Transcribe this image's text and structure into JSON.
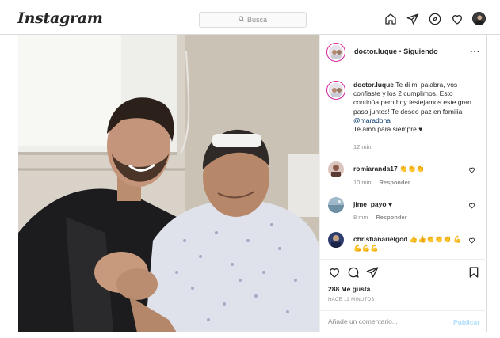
{
  "app": {
    "logo": "Instagram"
  },
  "search": {
    "placeholder": "Busca"
  },
  "nav": {
    "icons": [
      "home-icon",
      "send-icon",
      "explore-icon",
      "heart-icon",
      "profile-avatar"
    ]
  },
  "post": {
    "author": "doctor.luque",
    "follow_status": "Siguiendo",
    "separator": "•",
    "more": "···",
    "caption": {
      "user": "doctor.luque",
      "text": "Te di mi palabra, vos confiaste y los 2 cumplimos. Esto continúa pero hoy festejamos este gran paso juntos! Te deseo paz en familia",
      "mention": "@maradona",
      "text_after": "Te amo para siempre ♥",
      "time": "12 min"
    },
    "comments": [
      {
        "user": "romiaranda17",
        "text": "👏👏👏",
        "time": "10 min",
        "reply": "Responder"
      },
      {
        "user": "jime_payo",
        "text": "♥",
        "time": "8 min",
        "reply": "Responder"
      },
      {
        "user": "christianarielgod",
        "text": "👍👍👏👏👏 💪💪💪💪",
        "time": "",
        "reply": ""
      }
    ],
    "likes": "288 Me gusta",
    "posted_ago": "HACE 12 MINUTOS",
    "add_comment_placeholder": "Añade un comentario...",
    "publish_label": "Publicar"
  },
  "colors": {
    "border": "#dbdbdb",
    "mention": "#00376b",
    "publish_disabled": "#b2dffc",
    "ring": "#d6249f"
  }
}
